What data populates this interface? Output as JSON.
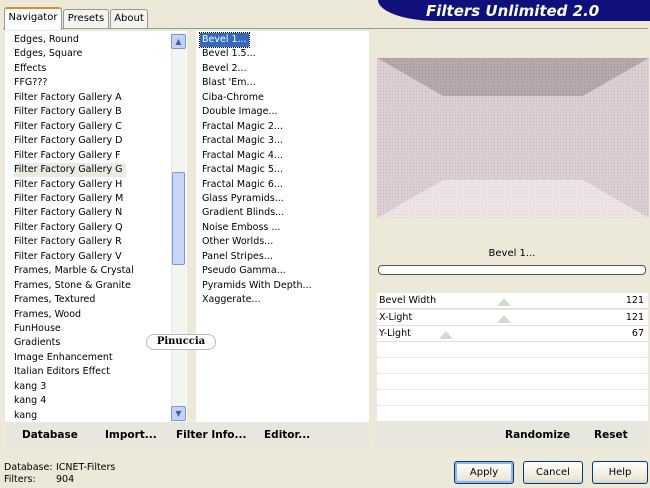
{
  "title": "Filters Unlimited 2.0",
  "tabs": [
    "Navigator",
    "Presets",
    "About"
  ],
  "categories": [
    "Edges, Round",
    "Edges, Square",
    "Effects",
    "FFG???",
    "Filter Factory Gallery A",
    "Filter Factory Gallery B",
    "Filter Factory Gallery C",
    "Filter Factory Gallery D",
    "Filter Factory Gallery F",
    "Filter Factory Gallery G",
    "Filter Factory Gallery H",
    "Filter Factory Gallery M",
    "Filter Factory Gallery N",
    "Filter Factory Gallery Q",
    "Filter Factory Gallery R",
    "Filter Factory Gallery V",
    "Frames, Marble & Crystal",
    "Frames, Stone & Granite",
    "Frames, Textured",
    "Frames, Wood",
    "FunHouse",
    "Gradients",
    "Image Enhancement",
    "Italian Editors Effect",
    "kang 3",
    "kang 4",
    "kang"
  ],
  "selected_category": "Filter Factory Gallery G",
  "filters": [
    "Bevel 1...",
    "Bevel 1.5...",
    "Bevel 2...",
    "Blast 'Em...",
    "Ciba-Chrome",
    "Double Image...",
    "Fractal Magic 2...",
    "Fractal Magic 3...",
    "Fractal Magic 4...",
    "Fractal Magic 5...",
    "Fractal Magic 6...",
    "Glass Pyramids...",
    "Gradient Blinds...",
    "Noise Emboss ...",
    "Other Worlds...",
    "Panel Stripes...",
    "Pseudo Gamma...",
    "Pyramids With Depth...",
    "Xaggerate..."
  ],
  "selected_filter": "Bevel 1...",
  "current_filter_name": "Bevel 1...",
  "sliders": [
    {
      "label": "Bevel Width",
      "value": "121",
      "level": 121
    },
    {
      "label": "X-Light",
      "value": "121",
      "level": 121
    },
    {
      "label": "Y-Light",
      "value": "67",
      "level": 67
    }
  ],
  "links": {
    "database": "Database",
    "import": "Import...",
    "filter_info": "Filter Info...",
    "editor": "Editor...",
    "randomize": "Randomize",
    "reset": "Reset"
  },
  "footer": {
    "database_label": "Database:",
    "database_value": "ICNET-Filters",
    "filters_label": "Filters:",
    "filters_value": "904"
  },
  "buttons": {
    "apply": "Apply",
    "cancel": "Cancel",
    "help": "Help"
  },
  "watermark": "Pinuccia",
  "icons": {
    "scroll_up": "scroll-up-arrow-icon",
    "scroll_down": "scroll-down-arrow-icon"
  },
  "colors": {
    "banner": "#10107c",
    "selection": "#316ac5",
    "preview_wall": "#d9ccd0",
    "preview_floor": "#ece3e5",
    "preview_dark": "#ad9ea2"
  }
}
